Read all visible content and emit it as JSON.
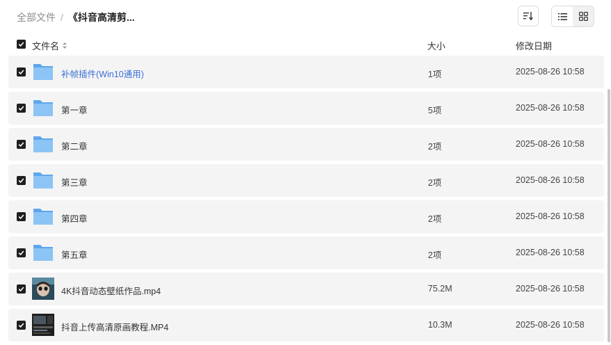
{
  "breadcrumb": {
    "root": "全部文件",
    "separator": "/",
    "current": "《抖音高清剪..."
  },
  "columns": {
    "name": "文件名",
    "size": "大小",
    "date": "修改日期"
  },
  "files": [
    {
      "name": "补帧插件(Win10通用)",
      "size": "1项",
      "date": "2025-08-26 10:58",
      "type": "folder"
    },
    {
      "name": "第一章",
      "size": "5项",
      "date": "2025-08-26 10:58",
      "type": "folder"
    },
    {
      "name": "第二章",
      "size": "2项",
      "date": "2025-08-26 10:58",
      "type": "folder"
    },
    {
      "name": "第三章",
      "size": "2项",
      "date": "2025-08-26 10:58",
      "type": "folder"
    },
    {
      "name": "第四章",
      "size": "2项",
      "date": "2025-08-26 10:58",
      "type": "folder"
    },
    {
      "name": "第五章",
      "size": "2项",
      "date": "2025-08-26 10:58",
      "type": "folder"
    },
    {
      "name": "4K抖音动态壁纸作品.mp4",
      "size": "75.2M",
      "date": "2025-08-26 10:58",
      "type": "video"
    },
    {
      "name": "抖音上传高清原画教程.MP4",
      "size": "10.3M",
      "date": "2025-08-26 10:58",
      "type": "video"
    }
  ],
  "colors": {
    "link": "#3a6fd8",
    "row_bg": "#f4f4f4",
    "checkbox": "#1f1f1f",
    "folder": "#7ab8f0"
  }
}
